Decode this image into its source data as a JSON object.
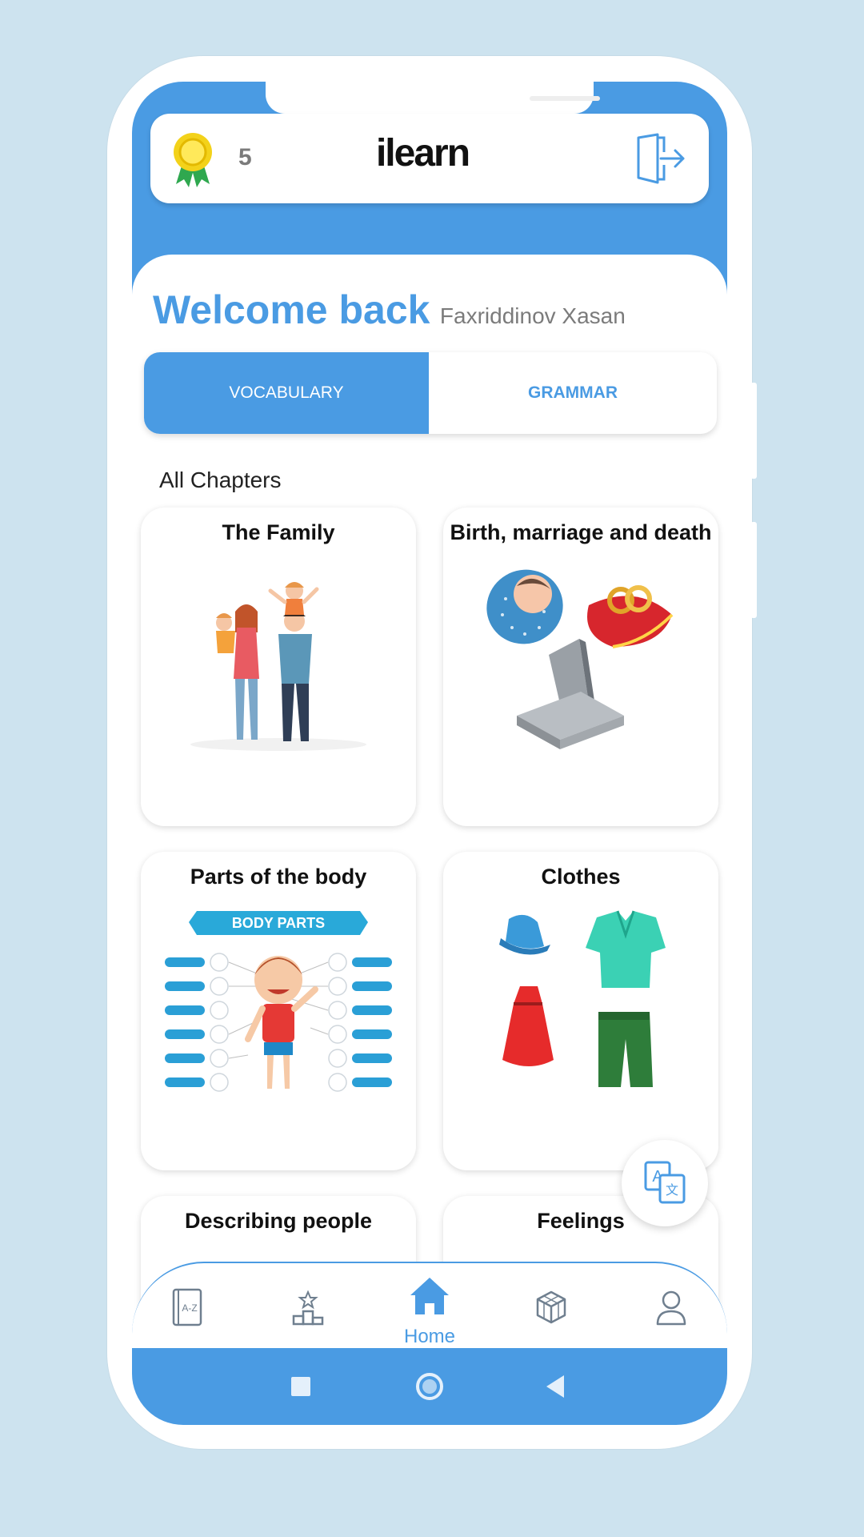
{
  "header": {
    "score": "5",
    "app_name": "ilearn",
    "icons": {
      "medal": "medal-icon",
      "logout": "logout-icon"
    }
  },
  "welcome": {
    "title": "Welcome back",
    "user_name": "Faxriddinov Xasan"
  },
  "tabs": [
    {
      "label": "VOCABULARY",
      "active": true
    },
    {
      "label": "GRAMMAR",
      "active": false
    }
  ],
  "chapters_label": "All Chapters",
  "chapters": [
    {
      "title": "The Family",
      "image": "family-illustration"
    },
    {
      "title": "Birth, marriage and death",
      "image": "birth-marriage-death-illustration"
    },
    {
      "title": "Parts of the body",
      "image": "body-parts-chart",
      "image_text": "BODY PARTS"
    },
    {
      "title": "Clothes",
      "image": "clothes-illustration"
    },
    {
      "title": "Describing people",
      "image": ""
    },
    {
      "title": "Feelings",
      "image": ""
    }
  ],
  "fab": {
    "icon": "translate-icon"
  },
  "bottom_nav": [
    {
      "icon": "dictionary-icon",
      "label": ""
    },
    {
      "icon": "leaderboard-icon",
      "label": ""
    },
    {
      "icon": "home-icon",
      "label": "Home",
      "active": true
    },
    {
      "icon": "cube-icon",
      "label": ""
    },
    {
      "icon": "profile-icon",
      "label": ""
    }
  ],
  "system_nav": [
    "recents-button",
    "home-button",
    "back-button"
  ],
  "colors": {
    "primary": "#4a9be3",
    "background": "#cde3ef",
    "text_secondary": "#7b7b7b"
  }
}
